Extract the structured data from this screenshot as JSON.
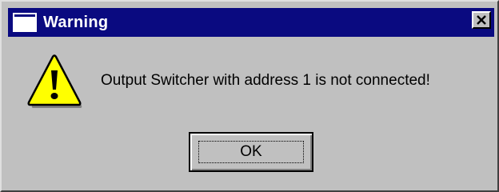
{
  "dialog": {
    "title": "Warning",
    "message": "Output Switcher with address 1 is not connected!",
    "ok_label": "OK"
  },
  "icons": {
    "app": "window-icon",
    "close": "close-icon",
    "alert": "warning-icon"
  },
  "colors": {
    "titlebar": "#0a0a80",
    "face": "#c0c0c0",
    "warning_fill": "#ffff00"
  }
}
